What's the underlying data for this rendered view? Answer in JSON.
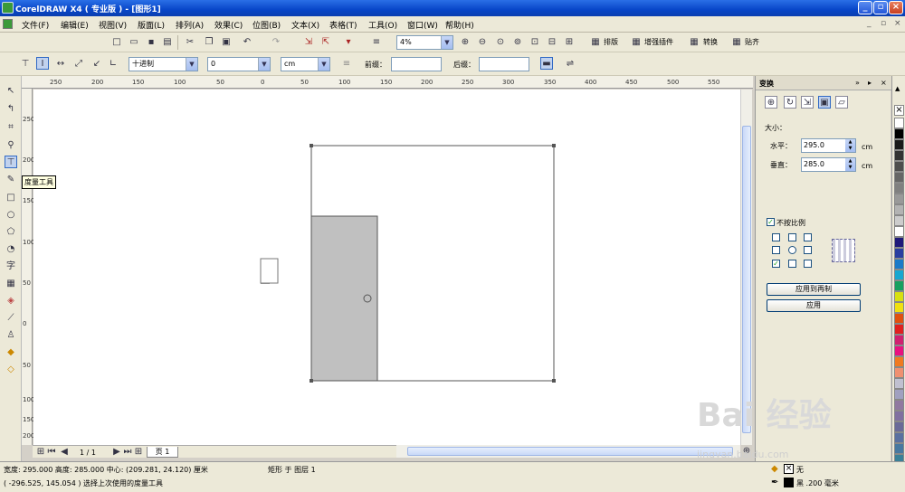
{
  "window": {
    "title": "CorelDRAW X4 ( 专业版 ) - [图形1]"
  },
  "menu": [
    "文件(F)",
    "编辑(E)",
    "视图(V)",
    "版面(L)",
    "排列(A)",
    "效果(C)",
    "位图(B)",
    "文本(X)",
    "表格(T)",
    "工具(O)",
    "窗口(W)",
    "帮助(H)"
  ],
  "toolbar": {
    "zoom": "4%",
    "layout_btn": "排版",
    "enhance_btn": "增强插件",
    "convert_btn": "转换",
    "snap_btn": "贴齐"
  },
  "propbar": {
    "decimal": "十进制",
    "precision": "0",
    "unit": "cm",
    "prefix_label": "前缀：",
    "suffix_label": "后缀：",
    "prefix_value": "",
    "suffix_value": ""
  },
  "ruler": {
    "h_ticks": [
      "250",
      "200",
      "150",
      "100",
      "50",
      "0",
      "50",
      "100",
      "150",
      "200",
      "250",
      "300",
      "350",
      "400",
      "450",
      "500",
      "550"
    ],
    "v_ticks": [
      "250",
      "200",
      "150",
      "100",
      "50",
      "0",
      "50",
      "100",
      "150",
      "200"
    ]
  },
  "tooltip": "度量工具",
  "pagenav": {
    "page_count": "1 / 1",
    "tab": "页 1"
  },
  "docker": {
    "title": "变换",
    "size_label": "大小：",
    "h_label": "水平：",
    "h_value": "295.0",
    "v_label": "垂直：",
    "v_value": "285.0",
    "unit1": "cm",
    "unit2": "cm",
    "nonprop_label": "不按比例",
    "apply_dup": "应用到再制",
    "apply": "应用"
  },
  "status": {
    "line1": "宽度: 295.000  高度: 285.000  中心: (209.281, 24.120)  厘米",
    "layer": "矩形 于 图层 1",
    "line2": "( -296.525, 145.054 )  选择上次使用的度量工具",
    "fill_label": "无",
    "outline_label": "黑  .200 毫米"
  },
  "palette": [
    "#ffffff",
    "#000000",
    "#1a1a1a",
    "#333333",
    "#4d4d4d",
    "#666666",
    "#808080",
    "#999999",
    "#b3b3b3",
    "#cccccc",
    "#ffffff",
    "#1f1a7a",
    "#2a3fa0",
    "#1c7ac8",
    "#17a7d0",
    "#17a060",
    "#d8e010",
    "#f0e010",
    "#e05010",
    "#e02020",
    "#d02070",
    "#e81080",
    "#f07a20",
    "#f09070",
    "#c0c0d0",
    "#a0a0c0",
    "#9078a0",
    "#8070a0",
    "#6a6a98",
    "#5a70a0",
    "#4878a0",
    "#3a8098",
    "#40a0a0"
  ],
  "colors": {
    "titlebar": "#0846c8",
    "shape_fill": "#c0c0c0",
    "selected": "#316ac5"
  },
  "watermark": {
    "text": "Bai 经验",
    "url": "jingyan.baidu.com"
  }
}
